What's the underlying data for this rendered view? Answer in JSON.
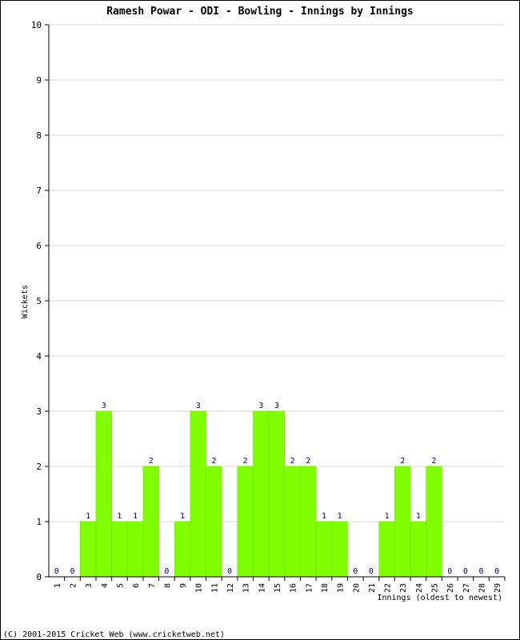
{
  "chart_data": {
    "type": "bar",
    "title": "Ramesh Powar - ODI - Bowling - Innings by Innings",
    "xlabel": "Innings (oldest to newest)",
    "ylabel": "Wickets",
    "ylim": [
      0,
      10
    ],
    "yticks": [
      0,
      1,
      2,
      3,
      4,
      5,
      6,
      7,
      8,
      9,
      10
    ],
    "grid": true,
    "categories": [
      "1",
      "2",
      "3",
      "4",
      "5",
      "6",
      "7",
      "8",
      "9",
      "10",
      "11",
      "12",
      "13",
      "14",
      "15",
      "16",
      "17",
      "18",
      "19",
      "20",
      "21",
      "22",
      "23",
      "24",
      "25",
      "26",
      "27",
      "28",
      "29"
    ],
    "values": [
      0,
      0,
      1,
      3,
      1,
      1,
      2,
      0,
      1,
      3,
      2,
      0,
      2,
      3,
      3,
      2,
      2,
      1,
      1,
      0,
      0,
      1,
      2,
      1,
      2,
      0,
      0,
      0,
      0
    ],
    "bar_color": "#80ff00",
    "label_color": "#000080"
  },
  "footer": "(C) 2001-2015 Cricket Web (www.cricketweb.net)"
}
